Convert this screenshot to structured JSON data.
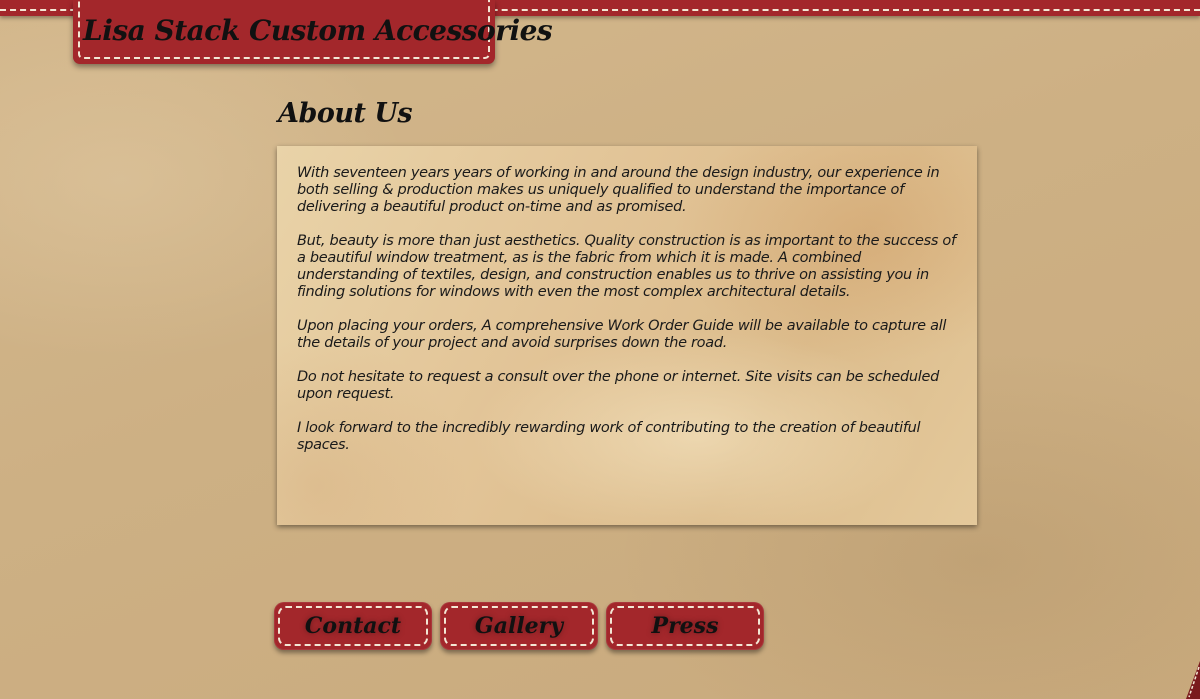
{
  "header": {
    "site_title": "Lisa Stack Custom Accessories"
  },
  "main": {
    "heading": "About Us",
    "paragraphs": [
      "With seventeen years years of working in and around the design industry, our experience in both selling & production makes us uniquely qualified to understand the importance of delivering a beautiful product on-time and as promised.",
      "But, beauty is more than just aesthetics. Quality construction is as important to the success of a beautiful window treatment, as is the fabric from which it is made. A combined understanding of textiles, design, and construction enables us to thrive on assisting you in finding solutions for windows with even the most complex architectural details.",
      "Upon placing your orders, A comprehensive Work Order Guide will be available to capture all the details of your project and avoid surprises down the road.",
      "Do not hesitate to request a consult over the phone or internet. Site visits can be scheduled upon request.",
      "I look forward to the incredibly rewarding work of contributing to the creation of beautiful spaces."
    ]
  },
  "nav": {
    "contact_label": "Contact",
    "gallery_label": "Gallery",
    "press_label": "Press"
  },
  "colors": {
    "accent_red": "#a3272b",
    "stitch": "#f3e7d5",
    "background_tan": "#cfb287",
    "parchment": "#e2c497"
  }
}
